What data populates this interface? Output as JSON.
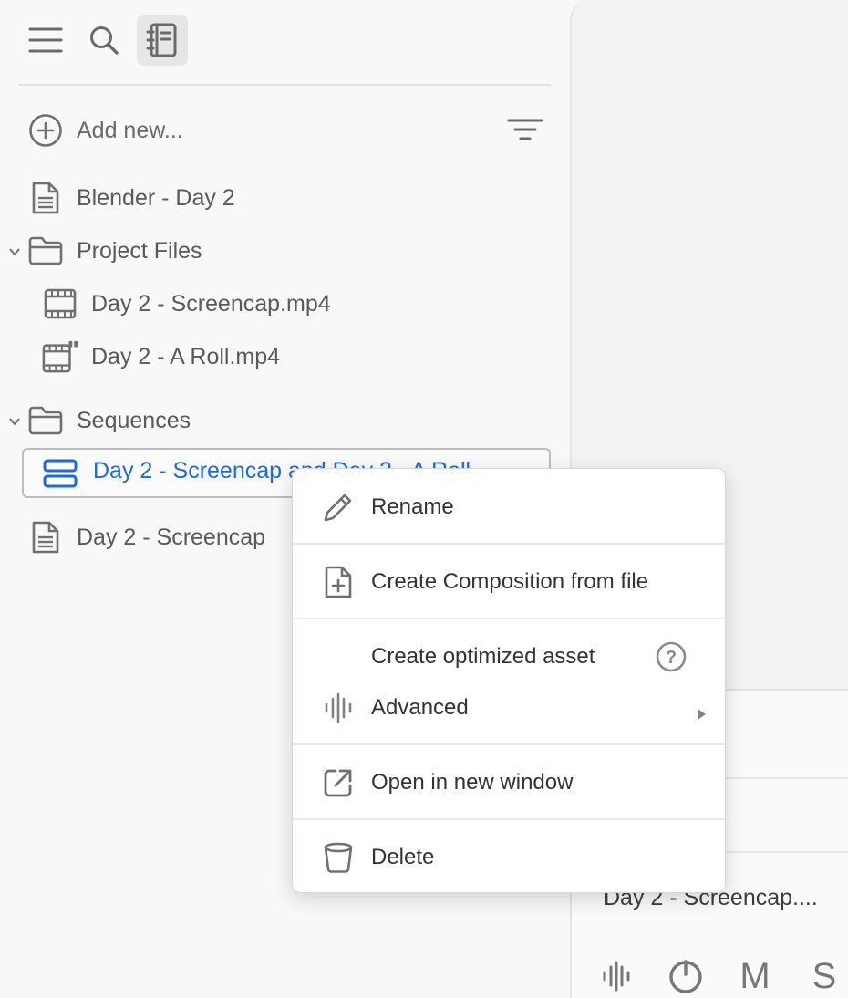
{
  "toolbar": {
    "menu_icon": "hamburger-menu-icon",
    "search_icon": "search-icon",
    "notebook_icon": "notebook-icon"
  },
  "sidebar": {
    "add_new_label": "Add new...",
    "items": [
      {
        "label": "Blender - Day 2",
        "icon": "document-icon"
      },
      {
        "label": "Project Files",
        "icon": "folder-icon",
        "expanded": true
      },
      {
        "label": "Day 2 - Screencap.mp4",
        "icon": "film-icon"
      },
      {
        "label": "Day 2 - A Roll.mp4",
        "icon": "film-transcript-icon"
      },
      {
        "label": "Sequences",
        "icon": "folder-icon",
        "expanded": true
      },
      {
        "label": "Day 2 - Screencap and Day 2 - A Roll",
        "icon": "sequence-icon",
        "selected": true
      },
      {
        "label": "Day 2 - Screencap",
        "icon": "document-icon"
      }
    ]
  },
  "context_menu": {
    "rename": "Rename",
    "create_composition": "Create Composition from file",
    "create_optimized": "Create optimized asset",
    "advanced": "Advanced",
    "open_new_window": "Open in new window",
    "delete": "Delete"
  },
  "panel": {
    "track_title": "Day 2 - Screencap....",
    "mute_label": "M",
    "solo_label": "S"
  },
  "colors": {
    "accent": "#1a6be0",
    "text": "#5a5a5a",
    "menu_text": "#333333"
  }
}
